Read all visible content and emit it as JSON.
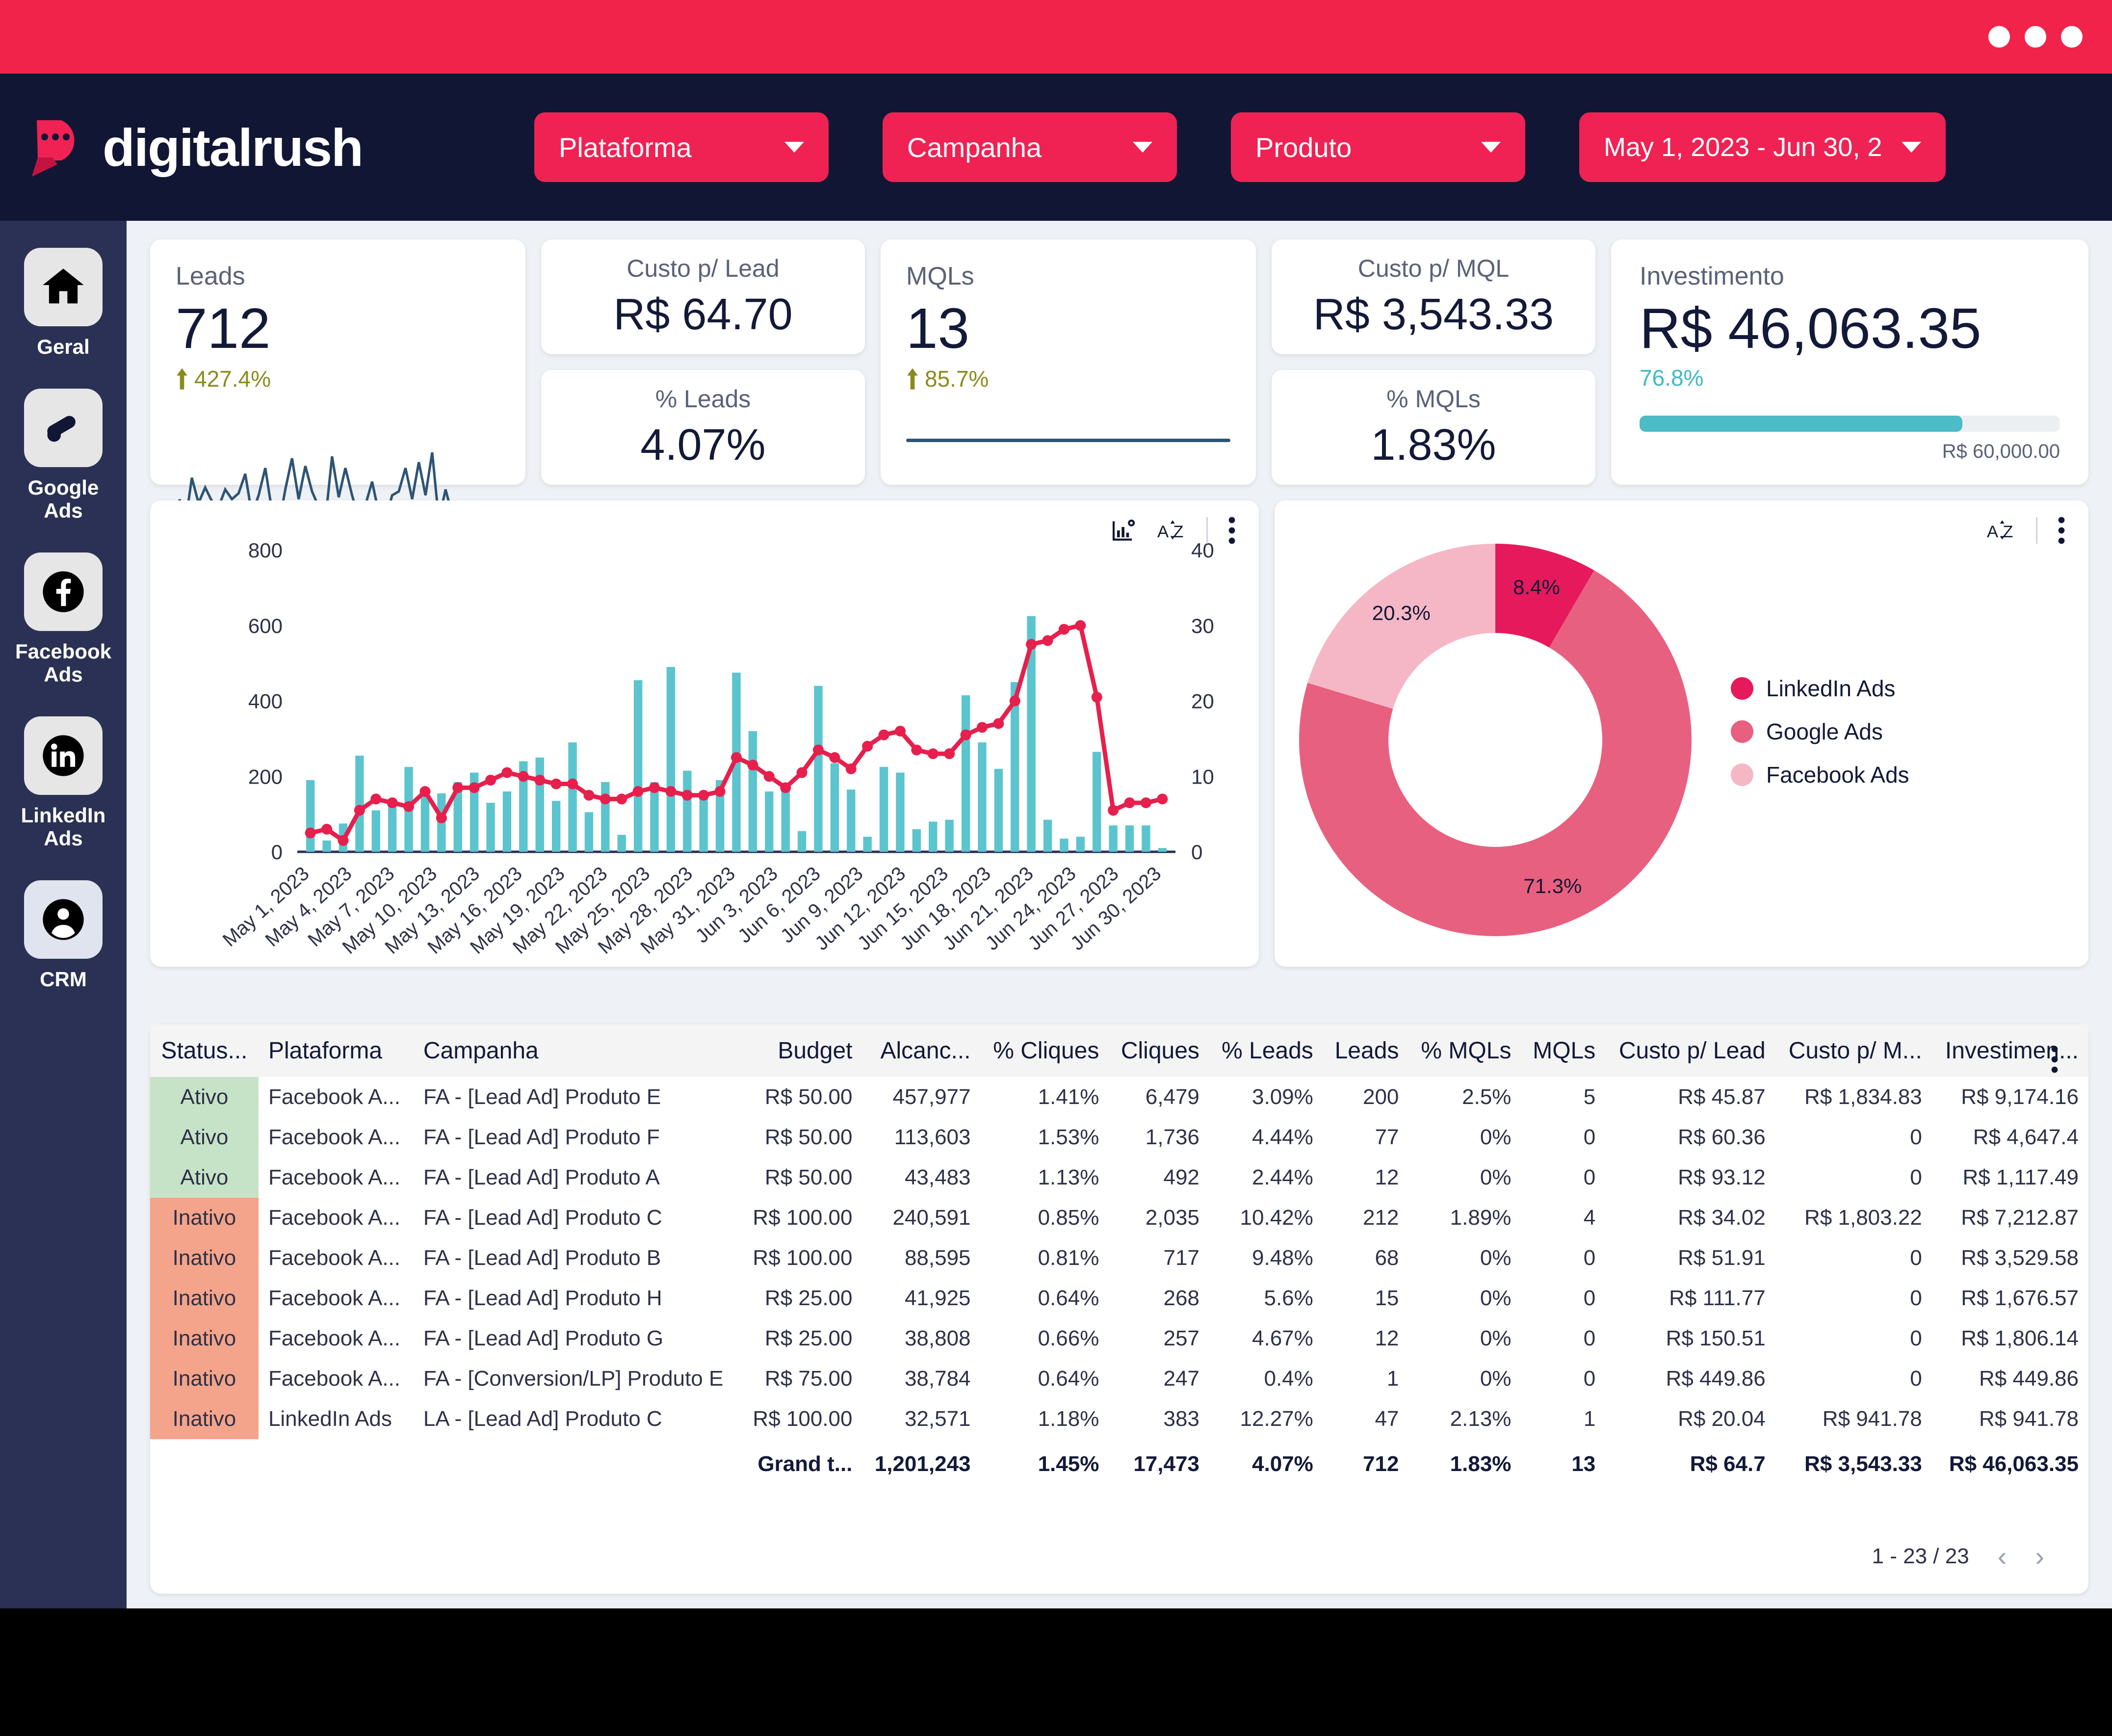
{
  "brand": {
    "name": "digitalrush",
    "accent": "#ef2253",
    "header_bg": "#111634"
  },
  "header": {
    "filters": [
      {
        "label": "Plataforma"
      },
      {
        "label": "Campanha"
      },
      {
        "label": "Produto"
      },
      {
        "label": "May 1, 2023 - Jun 30, 2"
      }
    ]
  },
  "sidebar": {
    "items": [
      {
        "label": "Geral",
        "icon": "home-icon"
      },
      {
        "label": "Google Ads",
        "icon": "google-ads-icon"
      },
      {
        "label": "Facebook Ads",
        "icon": "facebook-icon"
      },
      {
        "label": "LinkedIn Ads",
        "icon": "linkedin-icon"
      },
      {
        "label": "CRM",
        "icon": "person-icon"
      }
    ]
  },
  "kpis": {
    "leads": {
      "label": "Leads",
      "value": "712",
      "delta": "427.4%",
      "delta_color": "#8a8b1e"
    },
    "custo_lead": {
      "label": "Custo p/ Lead",
      "value": "R$ 64.70"
    },
    "pct_leads": {
      "label": "% Leads",
      "value": "4.07%"
    },
    "mqls": {
      "label": "MQLs",
      "value": "13",
      "delta": "85.7%"
    },
    "custo_mql": {
      "label": "Custo p/ MQL",
      "value": "R$ 3,543.33"
    },
    "pct_mqls": {
      "label": "% MQLs",
      "value": "1.83%"
    },
    "investimento": {
      "label": "Investimento",
      "value": "R$ 46,063.35",
      "pct": "76.8%",
      "pct_num": 76.8,
      "target": "R$ 60,000.00",
      "bar_color": "#4cbcc6"
    }
  },
  "chart_data": [
    {
      "type": "bar",
      "title": "",
      "xlabel": "",
      "ylabel": "",
      "legend": "none",
      "grid": false,
      "y_left_ticks": [
        0,
        200,
        400,
        600,
        800
      ],
      "y_right_ticks": [
        0,
        10,
        20,
        30,
        40
      ],
      "ylim": [
        0,
        800
      ],
      "y2lim": [
        0,
        40
      ],
      "bar_color": "#5bc4ce",
      "line_color": "#e61f4d",
      "x_tick_labels": [
        "May 1, 2023",
        "May 4, 2023",
        "May 7, 2023",
        "May 10, 2023",
        "May 13, 2023",
        "May 16, 2023",
        "May 19, 2023",
        "May 22, 2023",
        "May 25, 2023",
        "May 28, 2023",
        "May 31, 2023",
        "Jun 3, 2023",
        "Jun 6, 2023",
        "Jun 9, 2023",
        "Jun 12, 2023",
        "Jun 15, 2023",
        "Jun 18, 2023",
        "Jun 21, 2023",
        "Jun 24, 2023",
        "Jun 27, 2023",
        "Jun 30, 2023"
      ],
      "series": [
        {
          "name": "Leads",
          "axis": "left",
          "type": "bar",
          "values": [
            190,
            30,
            75,
            255,
            110,
            130,
            225,
            150,
            155,
            185,
            210,
            130,
            160,
            240,
            250,
            135,
            290,
            105,
            185,
            45,
            455,
            185,
            490,
            215,
            145,
            190,
            475,
            320,
            160,
            175,
            55,
            440,
            235,
            165,
            40,
            225,
            210,
            60,
            80,
            85,
            415,
            290,
            220,
            450,
            625,
            85,
            35,
            40,
            265,
            70,
            70,
            70,
            10
          ]
        },
        {
          "name": "MQLs",
          "axis": "right",
          "type": "line",
          "values": [
            2.5,
            3.0,
            1.5,
            5.5,
            7.0,
            6.5,
            6.0,
            8.0,
            4.5,
            8.5,
            8.5,
            9.5,
            10.5,
            10.0,
            9.5,
            9.0,
            9.0,
            7.5,
            7.0,
            7.0,
            8.0,
            8.5,
            8.0,
            7.5,
            7.5,
            8.0,
            12.5,
            11.5,
            10.0,
            8.5,
            10.5,
            13.5,
            12.5,
            11.0,
            14.0,
            15.5,
            16.0,
            13.5,
            13.0,
            13.0,
            15.5,
            16.5,
            17.0,
            20.0,
            27.5,
            28.0,
            29.5,
            30.0,
            20.5,
            5.5,
            6.5,
            6.5,
            7.0
          ]
        }
      ]
    },
    {
      "type": "pie",
      "title": "",
      "legend": "right",
      "labels": [
        "LinkedIn Ads",
        "Google Ads",
        "Facebook Ads"
      ],
      "values": [
        8.4,
        71.3,
        20.3
      ],
      "value_labels": [
        "8.4%",
        "71.3%",
        "20.3%"
      ],
      "colors": [
        "#e6195c",
        "#e8607f",
        "#f5b7c6"
      ]
    }
  ],
  "table": {
    "headers": [
      "Status...",
      "Plataforma",
      "Campanha",
      "Budget",
      "Alcanc...",
      "% Cliques",
      "Cliques",
      "% Leads",
      "Leads",
      "% MQLs",
      "MQLs",
      "Custo p/ Lead",
      "Custo p/ M...",
      "Investimen..."
    ],
    "rows": [
      {
        "status": "Ativo",
        "plataforma": "Facebook A...",
        "campanha": "FA - [Lead Ad] Produto E",
        "budget": "R$ 50.00",
        "alcance": "457,977",
        "pct_cliques": "1.41%",
        "cliques": "6,479",
        "pct_leads": "3.09%",
        "leads": "200",
        "pct_mqls": "2.5%",
        "mqls": "5",
        "custo_lead": "R$ 45.87",
        "custo_mql": "R$ 1,834.83",
        "investimento": "R$ 9,174.16"
      },
      {
        "status": "Ativo",
        "plataforma": "Facebook A...",
        "campanha": "FA - [Lead Ad] Produto F",
        "budget": "R$ 50.00",
        "alcance": "113,603",
        "pct_cliques": "1.53%",
        "cliques": "1,736",
        "pct_leads": "4.44%",
        "leads": "77",
        "pct_mqls": "0%",
        "mqls": "0",
        "custo_lead": "R$ 60.36",
        "custo_mql": "0",
        "investimento": "R$ 4,647.4"
      },
      {
        "status": "Ativo",
        "plataforma": "Facebook A...",
        "campanha": "FA - [Lead Ad] Produto A",
        "budget": "R$ 50.00",
        "alcance": "43,483",
        "pct_cliques": "1.13%",
        "cliques": "492",
        "pct_leads": "2.44%",
        "leads": "12",
        "pct_mqls": "0%",
        "mqls": "0",
        "custo_lead": "R$ 93.12",
        "custo_mql": "0",
        "investimento": "R$ 1,117.49"
      },
      {
        "status": "Inativo",
        "plataforma": "Facebook A...",
        "campanha": "FA - [Lead Ad] Produto C",
        "budget": "R$ 100.00",
        "alcance": "240,591",
        "pct_cliques": "0.85%",
        "cliques": "2,035",
        "pct_leads": "10.42%",
        "leads": "212",
        "pct_mqls": "1.89%",
        "mqls": "4",
        "custo_lead": "R$ 34.02",
        "custo_mql": "R$ 1,803.22",
        "investimento": "R$ 7,212.87"
      },
      {
        "status": "Inativo",
        "plataforma": "Facebook A...",
        "campanha": "FA - [Lead Ad] Produto B",
        "budget": "R$ 100.00",
        "alcance": "88,595",
        "pct_cliques": "0.81%",
        "cliques": "717",
        "pct_leads": "9.48%",
        "leads": "68",
        "pct_mqls": "0%",
        "mqls": "0",
        "custo_lead": "R$ 51.91",
        "custo_mql": "0",
        "investimento": "R$ 3,529.58"
      },
      {
        "status": "Inativo",
        "plataforma": "Facebook A...",
        "campanha": "FA - [Lead Ad] Produto H",
        "budget": "R$ 25.00",
        "alcance": "41,925",
        "pct_cliques": "0.64%",
        "cliques": "268",
        "pct_leads": "5.6%",
        "leads": "15",
        "pct_mqls": "0%",
        "mqls": "0",
        "custo_lead": "R$ 111.77",
        "custo_mql": "0",
        "investimento": "R$ 1,676.57"
      },
      {
        "status": "Inativo",
        "plataforma": "Facebook A...",
        "campanha": "FA - [Lead Ad] Produto G",
        "budget": "R$ 25.00",
        "alcance": "38,808",
        "pct_cliques": "0.66%",
        "cliques": "257",
        "pct_leads": "4.67%",
        "leads": "12",
        "pct_mqls": "0%",
        "mqls": "0",
        "custo_lead": "R$ 150.51",
        "custo_mql": "0",
        "investimento": "R$ 1,806.14"
      },
      {
        "status": "Inativo",
        "plataforma": "Facebook A...",
        "campanha": "FA - [Conversion/LP] Produto E",
        "budget": "R$ 75.00",
        "alcance": "38,784",
        "pct_cliques": "0.64%",
        "cliques": "247",
        "pct_leads": "0.4%",
        "leads": "1",
        "pct_mqls": "0%",
        "mqls": "0",
        "custo_lead": "R$ 449.86",
        "custo_mql": "0",
        "investimento": "R$ 449.86"
      },
      {
        "status": "Inativo",
        "plataforma": "LinkedIn Ads",
        "campanha": "LA - [Lead Ad] Produto C",
        "budget": "R$ 100.00",
        "alcance": "32,571",
        "pct_cliques": "1.18%",
        "cliques": "383",
        "pct_leads": "12.27%",
        "leads": "47",
        "pct_mqls": "2.13%",
        "mqls": "1",
        "custo_lead": "R$ 20.04",
        "custo_mql": "R$ 941.78",
        "investimento": "R$ 941.78"
      }
    ],
    "total": {
      "label": "Grand t...",
      "alcance": "1,201,243",
      "pct_cliques": "1.45%",
      "cliques": "17,473",
      "pct_leads": "4.07%",
      "leads": "712",
      "pct_mqls": "1.83%",
      "mqls": "13",
      "custo_lead": "R$ 64.7",
      "custo_mql": "R$ 3,543.33",
      "investimento": "R$ 46,063.35"
    },
    "pagination": {
      "range": "1 - 23 / 23",
      "prev": "‹",
      "next": "›"
    }
  }
}
